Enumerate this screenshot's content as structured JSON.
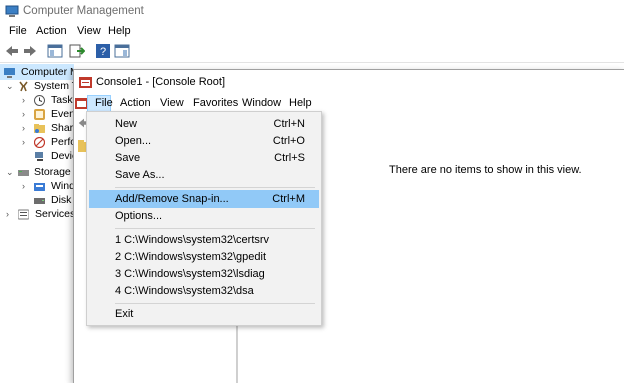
{
  "back_window": {
    "title": "Computer Management",
    "menu": [
      "File",
      "Action",
      "View",
      "Help"
    ],
    "tree": [
      {
        "label": "Computer M",
        "indent": 0
      },
      {
        "label": "System T",
        "indent": 1
      },
      {
        "label": "Task",
        "indent": 2
      },
      {
        "label": "Even",
        "indent": 2
      },
      {
        "label": "Share",
        "indent": 2
      },
      {
        "label": "Perfo",
        "indent": 2
      },
      {
        "label": "Devic",
        "indent": 2
      },
      {
        "label": "Storage",
        "indent": 1
      },
      {
        "label": "Wind",
        "indent": 2
      },
      {
        "label": "Disk",
        "indent": 2
      },
      {
        "label": "Services",
        "indent": 1
      }
    ]
  },
  "console": {
    "title": "Console1 - [Console Root]",
    "menu": [
      "File",
      "Action",
      "View",
      "Favorites",
      "Window",
      "Help"
    ],
    "empty_text": "There are no items to show in this view."
  },
  "file_menu": {
    "items": [
      {
        "label": "New",
        "accel": "Ctrl+N"
      },
      {
        "label": "Open...",
        "accel": "Ctrl+O"
      },
      {
        "label": "Save",
        "accel": "Ctrl+S"
      },
      {
        "label": "Save As...",
        "accel": ""
      },
      {
        "label": "Add/Remove Snap-in...",
        "accel": "Ctrl+M",
        "highlighted": true
      },
      {
        "label": "Options...",
        "accel": ""
      },
      {
        "label": "1 C:\\Windows\\system32\\certsrv",
        "accel": ""
      },
      {
        "label": "2 C:\\Windows\\system32\\gpedit",
        "accel": ""
      },
      {
        "label": "3 C:\\Windows\\system32\\lsdiag",
        "accel": ""
      },
      {
        "label": "4 C:\\Windows\\system32\\dsa",
        "accel": ""
      },
      {
        "label": "Exit",
        "accel": ""
      }
    ]
  },
  "colors": {
    "highlight": "#91c9f7",
    "menubar_highlight": "#cce8ff",
    "menu_bg": "#f2f2f2"
  }
}
